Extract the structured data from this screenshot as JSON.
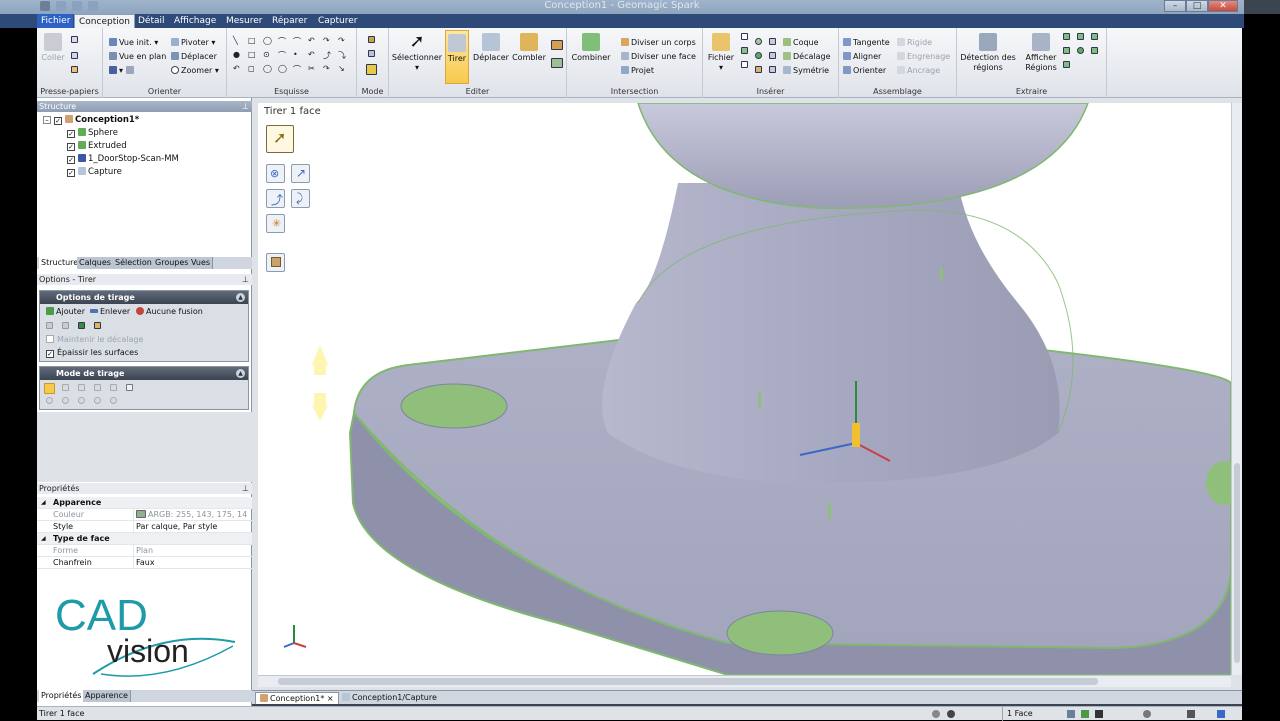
{
  "app": {
    "title": "Conception1 - Geomagic Spark"
  },
  "menu": {
    "file": "Fichier",
    "tabs": [
      "Conception",
      "Détail",
      "Affichage",
      "Mesurer",
      "Réparer",
      "Capturer"
    ],
    "active_tab": "Conception"
  },
  "ribbon": {
    "presse_papiers": {
      "label": "Presse-papiers",
      "coller": "Coller"
    },
    "orienter": {
      "label": "Orienter",
      "vue_init": "Vue init.",
      "vue_en_plan": "Vue en plan",
      "pivoter": "Pivoter",
      "deplacer": "Déplacer",
      "zoomer": "Zoomer"
    },
    "esquisse": {
      "label": "Esquisse"
    },
    "mode": {
      "label": "Mode"
    },
    "editer": {
      "label": "Editer",
      "selectionner": "Sélectionner",
      "tirer": "Tirer",
      "deplacer": "Déplacer",
      "combler": "Combler"
    },
    "intersection": {
      "label": "Intersection",
      "combiner": "Combiner",
      "diviser_corps": "Diviser un corps",
      "diviser_face": "Diviser une face",
      "projet": "Projet"
    },
    "inserer": {
      "label": "Insérer",
      "fichier": "Fichier",
      "coque": "Coque",
      "decalage": "Décalage",
      "symetrie": "Symétrie"
    },
    "assemblage": {
      "label": "Assemblage",
      "tangente": "Tangente",
      "aligner": "Aligner",
      "orienter": "Orienter",
      "rigide": "Rigide",
      "engrenage": "Engrenage",
      "ancrage": "Ancrage"
    },
    "extraire": {
      "label": "Extraire",
      "detection": "Détection des régions",
      "afficher": "Afficher Régions"
    }
  },
  "structure": {
    "title": "Structure",
    "root": "Conception1*",
    "items": [
      "Sphere",
      "Extruded",
      "1_DoorStop-Scan-MM",
      "Capture"
    ],
    "tabs": [
      "Structure",
      "Calques",
      "Sélection",
      "Groupes",
      "Vues"
    ]
  },
  "options": {
    "title": "Options - Tirer",
    "tirage_header": "Options de tirage",
    "ajouter": "Ajouter",
    "enlever": "Enlever",
    "aucune_fusion": "Aucune fusion",
    "maintenir": "Maintenir le décalage",
    "epaissir": "Épaissir les surfaces",
    "mode_header": "Mode de tirage"
  },
  "properties": {
    "title": "Propriétés",
    "rows": [
      {
        "k": "Apparence",
        "v": "",
        "cat": true
      },
      {
        "k": "Couleur",
        "v": "ARGB: 255, 143, 175, 14",
        "dis": true
      },
      {
        "k": "Style",
        "v": "Par calque, Par style"
      },
      {
        "k": "Type de face",
        "v": "",
        "cat": true
      },
      {
        "k": "Forme",
        "v": "Plan",
        "dis": true
      },
      {
        "k": "Chanfrein",
        "v": "Faux"
      }
    ],
    "tabs": [
      "Propriétés",
      "Apparence"
    ]
  },
  "logo": {
    "line1": "CAD",
    "line2": "vision"
  },
  "viewport": {
    "label": "Tirer 1 face"
  },
  "documents": {
    "tabs": [
      "Conception1*",
      "Conception1/Capture"
    ]
  },
  "status": {
    "left": "Tirer 1 face",
    "right": "1 Face"
  },
  "colors": {
    "accent": "#2d62c4",
    "model": "#a7a9c2",
    "highlight": "#8fbf7a"
  }
}
